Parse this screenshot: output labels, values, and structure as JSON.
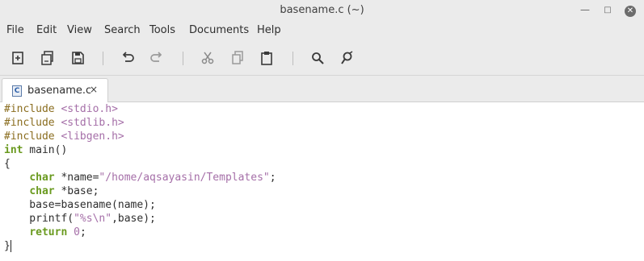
{
  "window": {
    "title": "basename.c (~)",
    "controls": {
      "minimize": "—",
      "maximize": "□",
      "close": "✕"
    }
  },
  "menu": [
    "File",
    "Edit",
    "View",
    "Search",
    "Tools",
    "Documents",
    "Help"
  ],
  "toolbar": {
    "buttons": [
      {
        "name": "new-file",
        "icon": "new-document-icon"
      },
      {
        "name": "open-file",
        "icon": "open-icon"
      },
      {
        "name": "save-file",
        "icon": "save-icon"
      },
      {
        "name": "undo",
        "icon": "undo-icon"
      },
      {
        "name": "redo",
        "icon": "redo-icon"
      },
      {
        "name": "cut",
        "icon": "cut-icon"
      },
      {
        "name": "copy",
        "icon": "copy-icon"
      },
      {
        "name": "paste",
        "icon": "paste-icon"
      },
      {
        "name": "find",
        "icon": "search-icon"
      },
      {
        "name": "find-replace",
        "icon": "replace-icon"
      }
    ]
  },
  "tabs": [
    {
      "label": "basename.c",
      "close": "×",
      "icon_letter": "C"
    }
  ],
  "code": {
    "lines": [
      {
        "tokens": [
          {
            "t": "#include ",
            "c": "pp"
          },
          {
            "t": "<stdio.h>",
            "c": "inc"
          }
        ]
      },
      {
        "tokens": [
          {
            "t": "#include ",
            "c": "pp"
          },
          {
            "t": "<stdlib.h>",
            "c": "inc"
          }
        ]
      },
      {
        "tokens": [
          {
            "t": "#include ",
            "c": "pp"
          },
          {
            "t": "<libgen.h>",
            "c": "inc"
          }
        ]
      },
      {
        "tokens": [
          {
            "t": "int",
            "c": "kw"
          },
          {
            "t": " main()",
            "c": ""
          }
        ]
      },
      {
        "tokens": [
          {
            "t": "{",
            "c": ""
          }
        ]
      },
      {
        "tokens": [
          {
            "t": "    ",
            "c": ""
          },
          {
            "t": "char",
            "c": "kw"
          },
          {
            "t": " *name=",
            "c": ""
          },
          {
            "t": "\"/home/aqsayasin/Templates\"",
            "c": "str"
          },
          {
            "t": ";",
            "c": ""
          }
        ]
      },
      {
        "tokens": [
          {
            "t": "    ",
            "c": ""
          },
          {
            "t": "char",
            "c": "kw"
          },
          {
            "t": " *base;",
            "c": ""
          }
        ]
      },
      {
        "tokens": [
          {
            "t": "    base=basename(name);",
            "c": ""
          }
        ]
      },
      {
        "tokens": [
          {
            "t": "    printf(",
            "c": ""
          },
          {
            "t": "\"%s\\n\"",
            "c": "str"
          },
          {
            "t": ",base);",
            "c": ""
          }
        ]
      },
      {
        "tokens": [
          {
            "t": "    ",
            "c": ""
          },
          {
            "t": "return",
            "c": "kw"
          },
          {
            "t": " ",
            "c": ""
          },
          {
            "t": "0",
            "c": "num"
          },
          {
            "t": ";",
            "c": ""
          }
        ]
      },
      {
        "tokens": [
          {
            "t": "}",
            "c": ""
          }
        ],
        "cursor": true
      }
    ]
  }
}
